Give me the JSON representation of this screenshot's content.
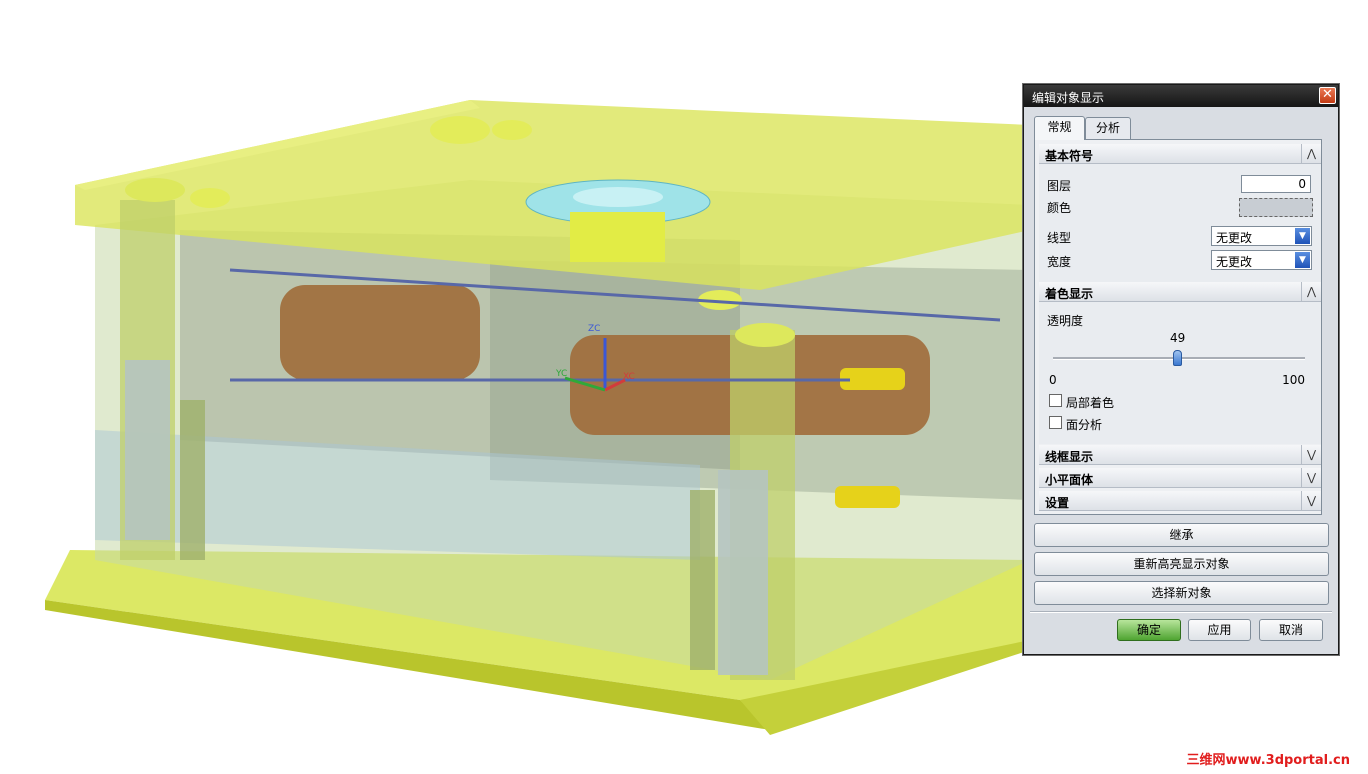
{
  "viewport": {
    "axes": {
      "z": "ZC",
      "y": "YC",
      "x": "XC"
    },
    "watermark": "三维网www.3dportal.cn"
  },
  "dialog": {
    "title": "编辑对象显示",
    "tabs": [
      "常规",
      "分析"
    ],
    "basic_symbol": {
      "header": "基本符号",
      "layer_label": "图层",
      "layer_value": "0",
      "color_label": "颜色",
      "linetype_label": "线型",
      "linetype_value": "无更改",
      "width_label": "宽度",
      "width_value": "无更改"
    },
    "shading": {
      "header": "着色显示",
      "transparency_label": "透明度",
      "transparency_value": "49",
      "slider_min": "0",
      "slider_max": "100",
      "partial_shading_label": "局部着色",
      "face_analysis_label": "面分析"
    },
    "collapsed_sections": [
      "线框显示",
      "小平面体",
      "设置"
    ],
    "buttons": {
      "inherit": "继承",
      "rehighlight": "重新高亮显示对象",
      "select_new": "选择新对象",
      "ok": "确定",
      "apply": "应用",
      "cancel": "取消"
    }
  }
}
